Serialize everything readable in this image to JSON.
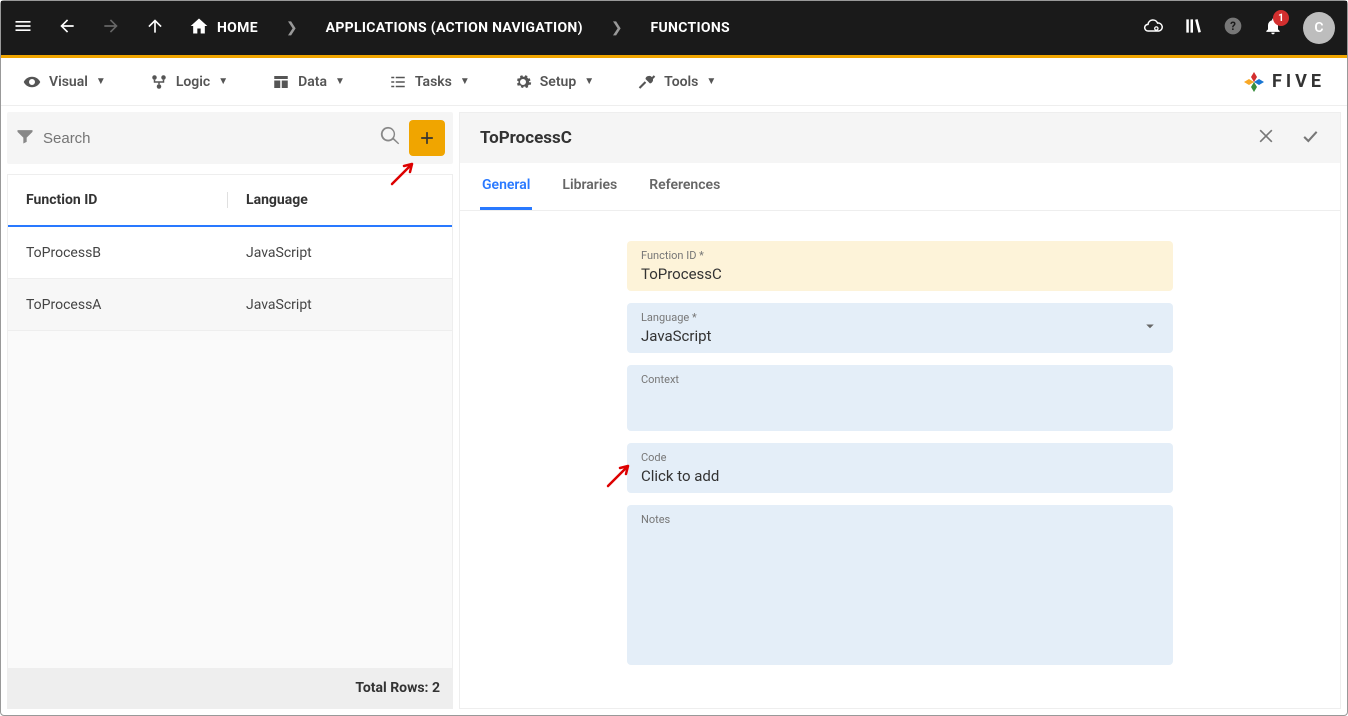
{
  "topbar": {
    "breadcrumbs": {
      "home": "HOME",
      "mid": "APPLICATIONS (ACTION NAVIGATION)",
      "last": "FUNCTIONS"
    },
    "badge": "1",
    "avatar": "C"
  },
  "menubar": {
    "items": [
      {
        "label": "Visual"
      },
      {
        "label": "Logic"
      },
      {
        "label": "Data"
      },
      {
        "label": "Tasks"
      },
      {
        "label": "Setup"
      },
      {
        "label": "Tools"
      }
    ],
    "brand": "FIVE"
  },
  "search": {
    "placeholder": "Search"
  },
  "list": {
    "headers": {
      "c1": "Function ID",
      "c2": "Language"
    },
    "rows": [
      {
        "id": "ToProcessB",
        "lang": "JavaScript"
      },
      {
        "id": "ToProcessA",
        "lang": "JavaScript"
      }
    ],
    "footer": "Total Rows: 2"
  },
  "detail": {
    "title": "ToProcessC",
    "tabs": [
      {
        "label": "General",
        "active": true
      },
      {
        "label": "Libraries"
      },
      {
        "label": "References"
      }
    ],
    "fields": {
      "functionId": {
        "label": "Function ID *",
        "value": "ToProcessC"
      },
      "language": {
        "label": "Language *",
        "value": "JavaScript"
      },
      "context": {
        "label": "Context",
        "value": ""
      },
      "code": {
        "label": "Code",
        "value": "Click to add"
      },
      "notes": {
        "label": "Notes",
        "value": ""
      }
    }
  }
}
